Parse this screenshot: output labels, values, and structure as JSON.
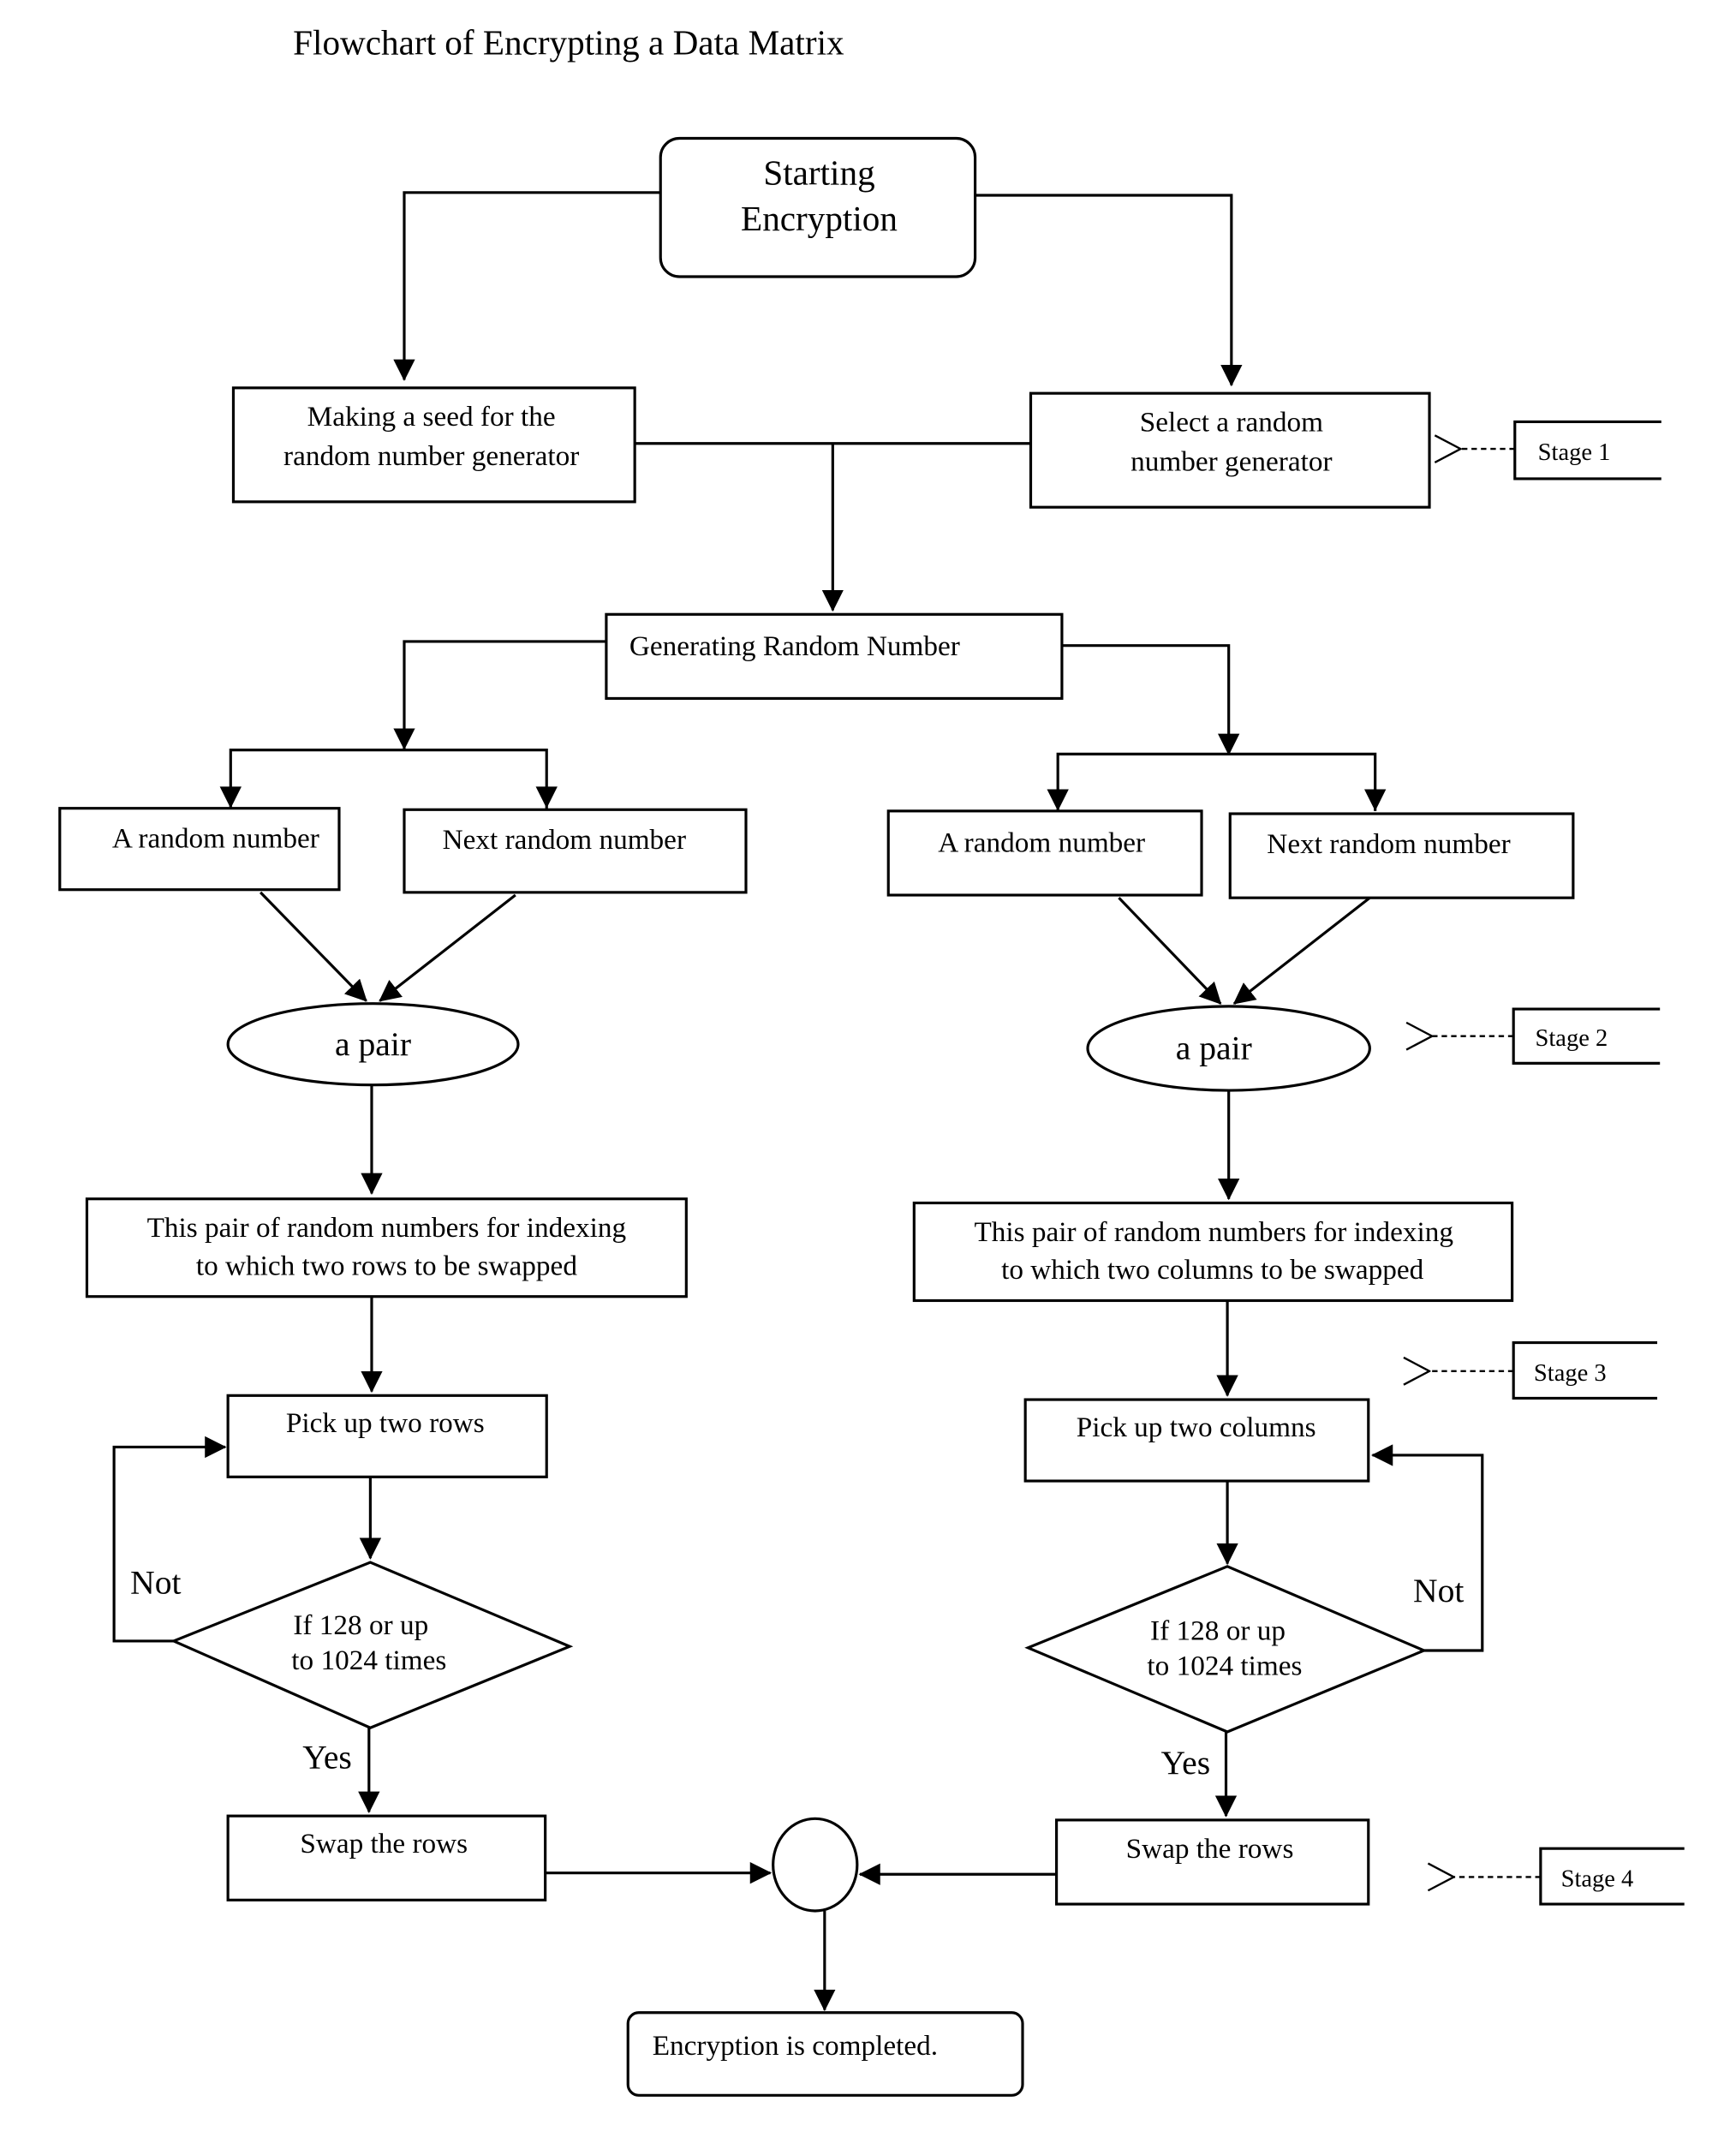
{
  "title": "Flowchart of Encrypting a Data Matrix",
  "nodes": {
    "start": {
      "line1": "Starting",
      "line2": "Encryption"
    },
    "seed": {
      "line1": "Making a seed for the",
      "line2": "random number generator"
    },
    "select_rng": {
      "line1": "Select a random",
      "line2": "number generator"
    },
    "generate": {
      "label": "Generating Random Number"
    },
    "left": {
      "random": "A random number",
      "next_random": "Next random number",
      "pair": "a pair",
      "index_line1": "This pair of random numbers for indexing",
      "index_line2": "to which two rows to be swapped",
      "pick": "Pick up two rows",
      "decision_line1": "If 128 or up",
      "decision_line2": "to 1024 times",
      "not_label": "Not",
      "yes_label": "Yes",
      "swap": "Swap the rows"
    },
    "right": {
      "random": "A random number",
      "next_random": "Next random number",
      "pair": "a pair",
      "index_line1": "This pair of random numbers for indexing",
      "index_line2": "to which two columns to be swapped",
      "pick": "Pick up two columns",
      "decision_line1": "If 128 or  up",
      "decision_line2": "to 1024 times",
      "not_label": "Not",
      "yes_label": "Yes",
      "swap": "Swap the rows"
    },
    "end": {
      "label": "Encryption is completed."
    }
  },
  "stages": [
    "Stage 1",
    "Stage 2",
    "Stage 3",
    "Stage 4"
  ]
}
